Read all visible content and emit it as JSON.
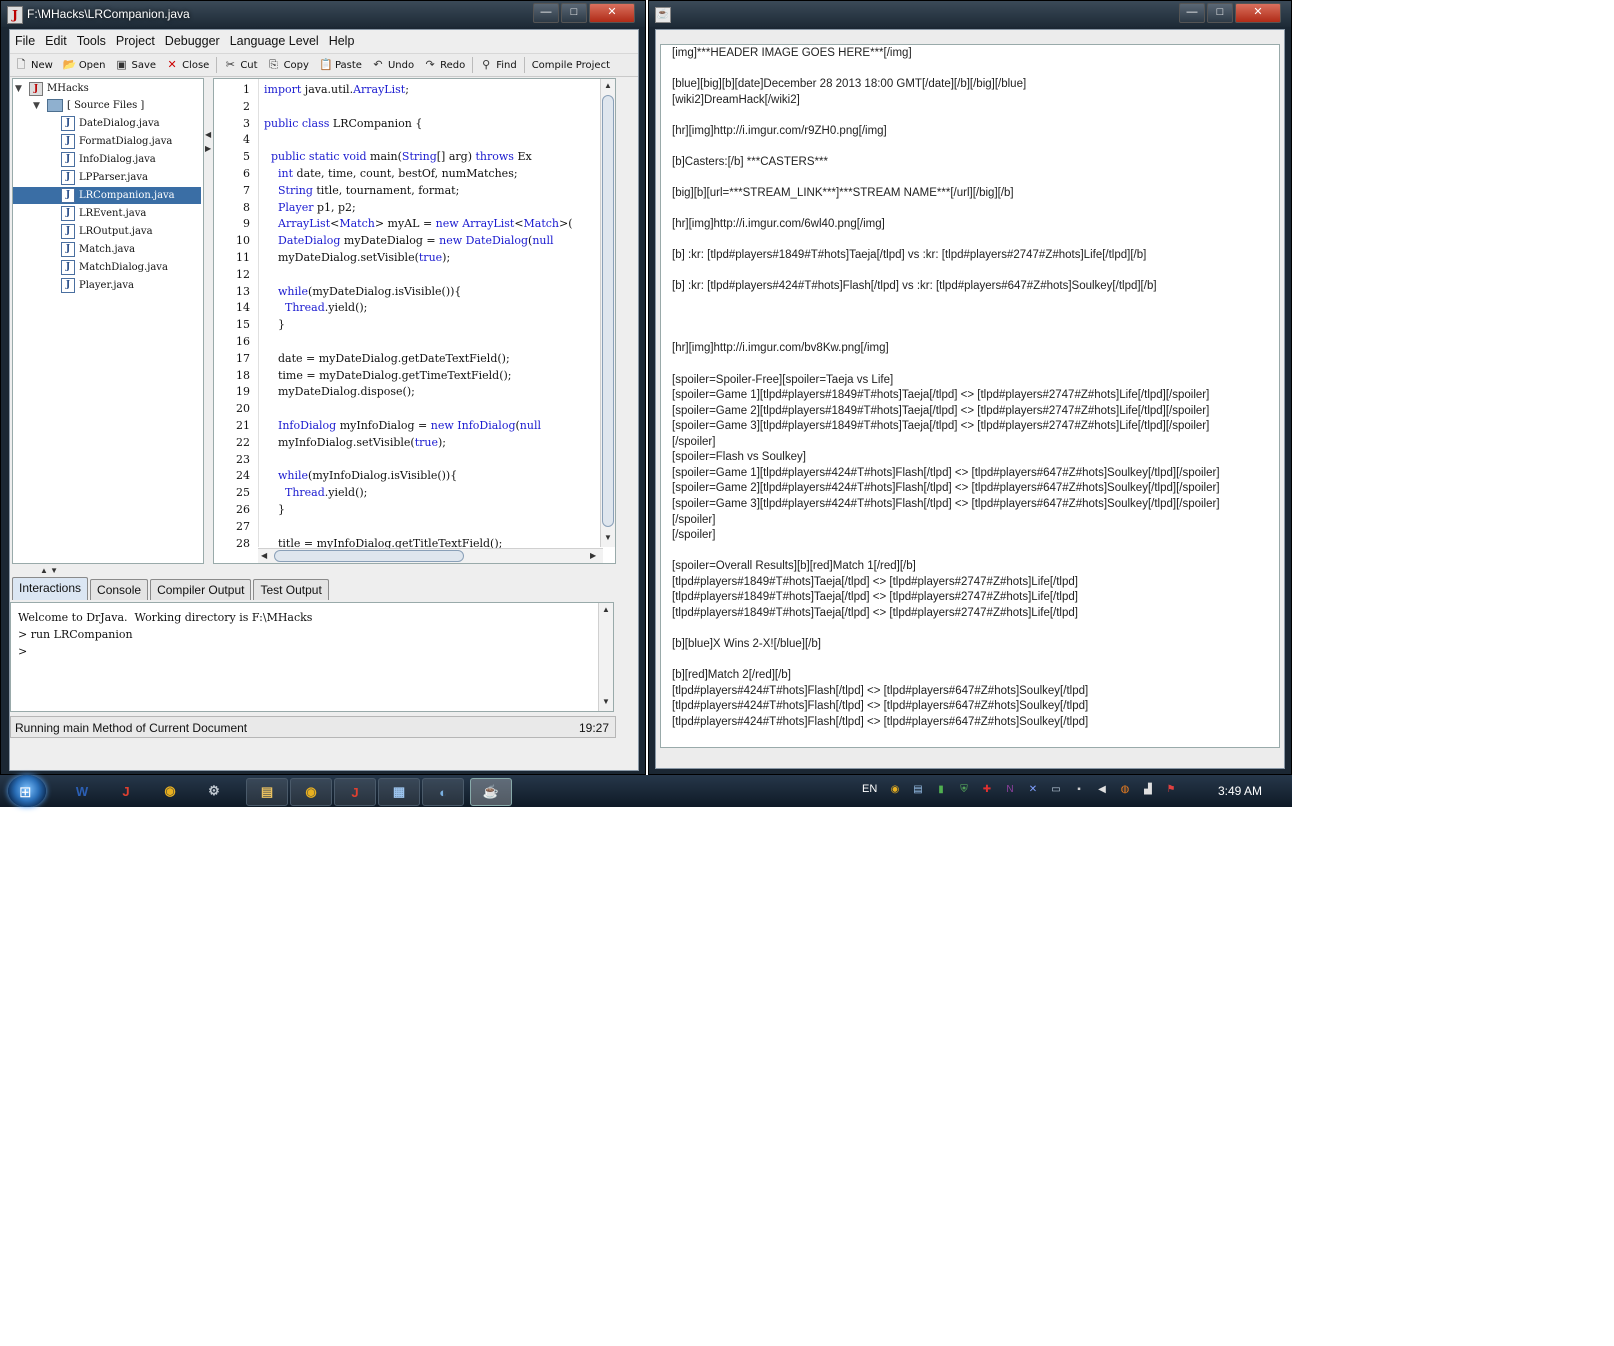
{
  "left_window": {
    "title": "F:\\MHacks\\LRCompanion.java",
    "buttons": [
      "—",
      "□",
      "✕"
    ],
    "menu": [
      "File",
      "Edit",
      "Tools",
      "Project",
      "Debugger",
      "Language Level",
      "Help"
    ],
    "toolbar": [
      {
        "icon": "new-doc-icon",
        "label": "New"
      },
      {
        "icon": "open-folder-icon",
        "label": "Open"
      },
      {
        "icon": "save-disk-icon",
        "label": "Save"
      },
      {
        "icon": "close-doc-icon",
        "label": "Close"
      },
      {
        "icon": "scissors-icon",
        "label": "Cut"
      },
      {
        "icon": "copy-icon",
        "label": "Copy"
      },
      {
        "icon": "clipboard-icon",
        "label": "Paste"
      },
      {
        "icon": "undo-icon",
        "label": "Undo"
      },
      {
        "icon": "redo-icon",
        "label": "Redo"
      },
      {
        "icon": "binoculars-icon",
        "label": "Find"
      },
      {
        "icon": "",
        "label": "Compile Project"
      }
    ],
    "tree": {
      "root": "MHacks",
      "folder": "[ Source Files ]",
      "files": [
        "DateDialog.java",
        "FormatDialog.java",
        "InfoDialog.java",
        "LPParser.java",
        "LRCompanion.java",
        "LREvent.java",
        "LROutput.java",
        "Match.java",
        "MatchDialog.java",
        "Player.java"
      ],
      "selected_index": 4
    },
    "editor": {
      "line_numbers": [
        "1",
        "2",
        "3",
        "4",
        "5",
        "6",
        "7",
        "8",
        "9",
        "10",
        "11",
        "12",
        "13",
        "14",
        "15",
        "16",
        "17",
        "18",
        "19",
        "20",
        "21",
        "22",
        "23",
        "24",
        "25",
        "26",
        "27",
        "28"
      ],
      "lines": [
        "import java.util.ArrayList;",
        "",
        "public class LRCompanion {",
        "",
        "  public static void main(String[] arg) throws Ex",
        "    int date, time, count, bestOf, numMatches;",
        "    String title, tournament, format;",
        "    Player p1, p2;",
        "    ArrayList<Match> myAL = new ArrayList<Match>(",
        "    DateDialog myDateDialog = new DateDialog(null",
        "    myDateDialog.setVisible(true);",
        "",
        "    while(myDateDialog.isVisible()){",
        "      Thread.yield();",
        "    }",
        "",
        "    date = myDateDialog.getDateTextField();",
        "    time = myDateDialog.getTimeTextField();",
        "    myDateDialog.dispose();",
        "",
        "    InfoDialog myInfoDialog = new InfoDialog(null",
        "    myInfoDialog.setVisible(true);",
        "",
        "    while(myInfoDialog.isVisible()){",
        "      Thread.yield();",
        "    }",
        "",
        "    title = myInfoDialog.getTitleTextField();"
      ]
    },
    "bottom_tabs": [
      "Interactions",
      "Console",
      "Compiler Output",
      "Test Output"
    ],
    "active_tab": "Interactions",
    "interactions": [
      "Welcome to DrJava.  Working directory is F:\\MHacks",
      "> run LRCompanion",
      ">"
    ],
    "status_text": "Running main Method of Current Document",
    "cursor_pos": "19:27"
  },
  "right_window": {
    "buttons": [
      "—",
      "□",
      "✕"
    ],
    "lines": [
      "[img]***HEADER IMAGE GOES HERE***[/img]",
      "",
      "[blue][big][b][date]December 28 2013 18:00 GMT[/date][/b][/big][/blue]",
      "[wiki2]DreamHack[/wiki2]",
      "",
      "[hr][img]http://i.imgur.com/r9ZH0.png[/img]",
      "",
      "[b]Casters:[/b] ***CASTERS***",
      "",
      "[big][b][url=***STREAM_LINK***]***STREAM NAME***[/url][/big][/b]",
      "",
      "[hr][img]http://i.imgur.com/6wl40.png[/img]",
      "",
      "[b] :kr: [tlpd#players#1849#T#hots]Taeja[/tlpd] vs :kr: [tlpd#players#2747#Z#hots]Life[/tlpd][/b]",
      "",
      "[b] :kr: [tlpd#players#424#T#hots]Flash[/tlpd] vs :kr: [tlpd#players#647#Z#hots]Soulkey[/tlpd][/b]",
      "",
      "",
      "",
      "[hr][img]http://i.imgur.com/bv8Kw.png[/img]",
      "",
      "[spoiler=Spoiler-Free][spoiler=Taeja vs Life]",
      "[spoiler=Game 1][tlpd#players#1849#T#hots]Taeja[/tlpd] <> [tlpd#players#2747#Z#hots]Life[/tlpd][/spoiler]",
      "[spoiler=Game 2][tlpd#players#1849#T#hots]Taeja[/tlpd] <> [tlpd#players#2747#Z#hots]Life[/tlpd][/spoiler]",
      "[spoiler=Game 3][tlpd#players#1849#T#hots]Taeja[/tlpd] <> [tlpd#players#2747#Z#hots]Life[/tlpd][/spoiler]",
      "[/spoiler]",
      "[spoiler=Flash vs Soulkey]",
      "[spoiler=Game 1][tlpd#players#424#T#hots]Flash[/tlpd] <> [tlpd#players#647#Z#hots]Soulkey[/tlpd][/spoiler]",
      "[spoiler=Game 2][tlpd#players#424#T#hots]Flash[/tlpd] <> [tlpd#players#647#Z#hots]Soulkey[/tlpd][/spoiler]",
      "[spoiler=Game 3][tlpd#players#424#T#hots]Flash[/tlpd] <> [tlpd#players#647#Z#hots]Soulkey[/tlpd][/spoiler]",
      "[/spoiler]",
      "[/spoiler]",
      "",
      "[spoiler=Overall Results][b][red]Match 1[/red][/b]",
      "[tlpd#players#1849#T#hots]Taeja[/tlpd] <> [tlpd#players#2747#Z#hots]Life[/tlpd]",
      "[tlpd#players#1849#T#hots]Taeja[/tlpd] <> [tlpd#players#2747#Z#hots]Life[/tlpd]",
      "[tlpd#players#1849#T#hots]Taeja[/tlpd] <> [tlpd#players#2747#Z#hots]Life[/tlpd]",
      "",
      "[b][blue]X Wins 2-X![/blue][/b]",
      "",
      "[b][red]Match 2[/red][/b]",
      "[tlpd#players#424#T#hots]Flash[/tlpd] <> [tlpd#players#647#Z#hots]Soulkey[/tlpd]",
      "[tlpd#players#424#T#hots]Flash[/tlpd] <> [tlpd#players#647#Z#hots]Soulkey[/tlpd]",
      "[tlpd#players#424#T#hots]Flash[/tlpd] <> [tlpd#players#647#Z#hots]Soulkey[/tlpd]"
    ]
  },
  "taskbar": {
    "pinned": [
      {
        "name": "word-icon",
        "glyph": "W",
        "color": "#2b5fb4"
      },
      {
        "name": "drjava-icon",
        "glyph": "J",
        "color": "#e04030"
      },
      {
        "name": "chrome-icon",
        "glyph": "◉",
        "color": "#e8b020"
      },
      {
        "name": "tool-icon",
        "glyph": "⚙",
        "color": "#c0c8d0"
      },
      {
        "name": "explorer-icon",
        "glyph": "▤",
        "color": "#e8c060"
      },
      {
        "name": "chrome-icon",
        "glyph": "◉",
        "color": "#e8b020"
      },
      {
        "name": "drjava-icon",
        "glyph": "J",
        "color": "#e04030"
      },
      {
        "name": "notepad-icon",
        "glyph": "▦",
        "color": "#9cc4ee"
      },
      {
        "name": "paint-icon",
        "glyph": "◐",
        "color": "#7ab0e0"
      },
      {
        "name": "java-icon",
        "glyph": "☕",
        "color": "#e07020"
      }
    ],
    "language": "EN",
    "clock": "3:49 AM",
    "tray_icons": [
      {
        "name": "chrome-icon",
        "glyph": "◉",
        "color": "#e8b020"
      },
      {
        "name": "document-icon",
        "glyph": "▤",
        "color": "#9cc4ee"
      },
      {
        "name": "chart-icon",
        "glyph": "▮",
        "color": "#50b050"
      },
      {
        "name": "shield-icon",
        "glyph": "⛨",
        "color": "#60c060"
      },
      {
        "name": "pdf-icon",
        "glyph": "✚",
        "color": "#e03030"
      },
      {
        "name": "onenote-icon",
        "glyph": "N",
        "color": "#9040a0"
      },
      {
        "name": "tool-icon",
        "glyph": "✕",
        "color": "#80a0ff"
      },
      {
        "name": "monitor-icon",
        "glyph": "▭",
        "color": "#c0d0e0"
      },
      {
        "name": "usb-icon",
        "glyph": "▪",
        "color": "#d0d0d0"
      },
      {
        "name": "volume-icon",
        "glyph": "◀",
        "color": "#e0e0e0"
      },
      {
        "name": "update-icon",
        "glyph": "◍",
        "color": "#f08020"
      },
      {
        "name": "network-icon",
        "glyph": "▟",
        "color": "#e0e0e0"
      },
      {
        "name": "flag-icon",
        "glyph": "⚑",
        "color": "#e04040"
      }
    ]
  }
}
